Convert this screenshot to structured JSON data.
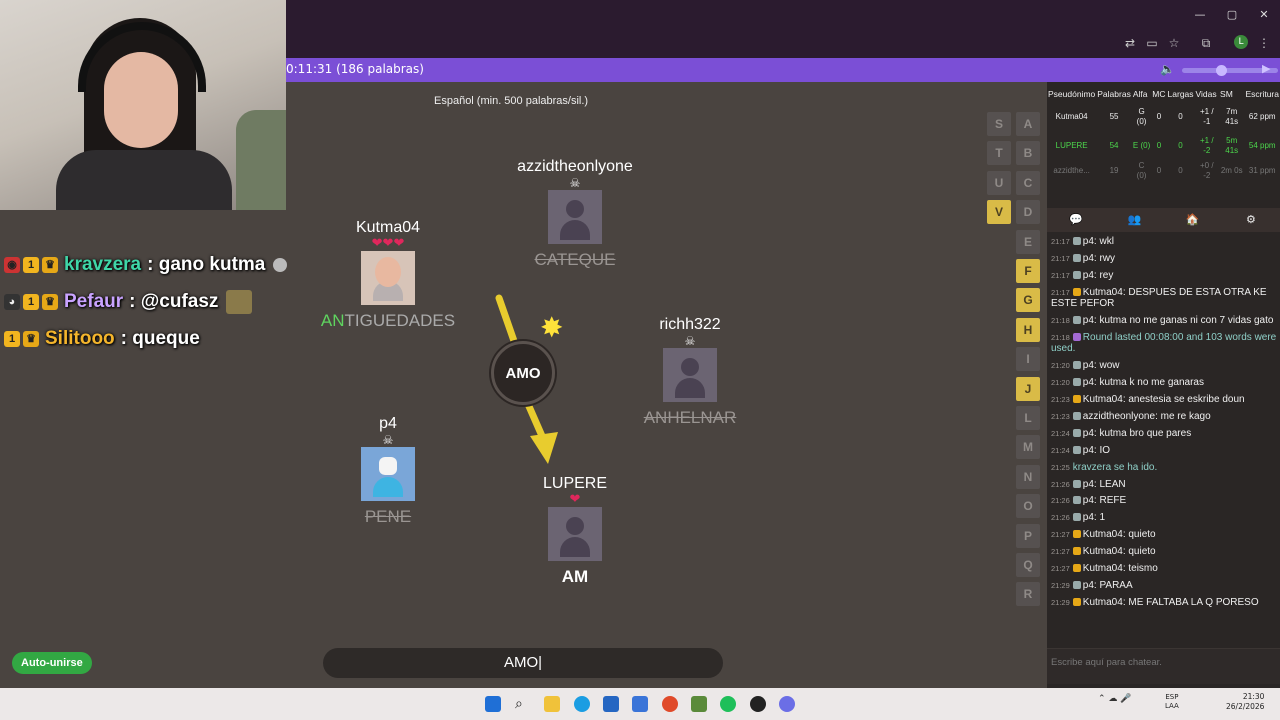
{
  "browser": {
    "window_controls": [
      "—",
      "▢",
      "✕"
    ],
    "profile_initial": "L"
  },
  "game_bar": {
    "timer": "0:11:31 (186 palabras)"
  },
  "stream_overlay": {
    "chat": [
      {
        "user": "kravzera",
        "user_color": "#3fd6a7",
        "message": ": gano kutma"
      },
      {
        "user": "Pefaur",
        "user_color": "#c9a3ff",
        "message": ": @cufasz"
      },
      {
        "user": "Silitooo",
        "user_color": "#f4b52c",
        "message": ": queque"
      }
    ]
  },
  "game": {
    "language": "Español (min. 500 palabras/sil.)",
    "bomb_syllable": "AMO",
    "players": [
      {
        "name": "azzidtheonlyone",
        "status": "dead",
        "word": "CATEQUE"
      },
      {
        "name": "Kutma04",
        "status": "alive",
        "lives": "❤❤❤",
        "word_highlight": "AN",
        "word_rest": "TIGUEDADES"
      },
      {
        "name": "richh322",
        "status": "dead",
        "word": "ANHELNAR"
      },
      {
        "name": "p4",
        "status": "dead",
        "word": "PENE"
      },
      {
        "name": "LUPERE",
        "status": "alive",
        "lives": "❤",
        "word": "AM"
      }
    ],
    "letters_col1": [
      {
        "letter": "S",
        "used": false
      },
      {
        "letter": "T",
        "used": false
      },
      {
        "letter": "U",
        "used": false
      },
      {
        "letter": "V",
        "used": true
      }
    ],
    "letters_col2": [
      {
        "letter": "A",
        "used": false
      },
      {
        "letter": "B",
        "used": false
      },
      {
        "letter": "C",
        "used": false
      },
      {
        "letter": "D",
        "used": false
      },
      {
        "letter": "E",
        "used": false
      },
      {
        "letter": "F",
        "used": true
      },
      {
        "letter": "G",
        "used": true
      },
      {
        "letter": "H",
        "used": true
      },
      {
        "letter": "I",
        "used": false
      },
      {
        "letter": "J",
        "used": true
      },
      {
        "letter": "L",
        "used": false
      },
      {
        "letter": "M",
        "used": false
      },
      {
        "letter": "N",
        "used": false
      },
      {
        "letter": "O",
        "used": false
      },
      {
        "letter": "P",
        "used": false
      },
      {
        "letter": "Q",
        "used": false
      },
      {
        "letter": "R",
        "used": false
      }
    ],
    "auto_join_label": "Auto-unirse",
    "input_value": "AMO"
  },
  "stats": {
    "headers": [
      "Pseudónimo",
      "Palabras",
      "Alfa",
      "MC",
      "Largas",
      "Vidas",
      "SM",
      "Escritura"
    ],
    "rows": [
      {
        "name": "Kutma04",
        "words": "55",
        "alfa": "G (0)",
        "mc": "0",
        "largas": "0",
        "vidas": "+1 / -1",
        "sm": "7m 41s",
        "speed": "62 ppm",
        "style": "normal"
      },
      {
        "name": "LUPERE",
        "words": "54",
        "alfa": "E (0)",
        "mc": "0",
        "largas": "0",
        "vidas": "+1 / -2",
        "sm": "5m 41s",
        "speed": "54 ppm",
        "style": "green"
      },
      {
        "name": "azzidthe...",
        "words": "19",
        "alfa": "C (0)",
        "mc": "0",
        "largas": "0",
        "vidas": "+0 / -2",
        "sm": "2m 0s",
        "speed": "31 ppm",
        "style": "faded"
      }
    ]
  },
  "chat": {
    "tabs": [
      "💬",
      "👥",
      "🏠",
      "⚙"
    ],
    "messages": [
      {
        "time": "21:17",
        "icon": "grey",
        "user": "p4",
        "text": "wkl"
      },
      {
        "time": "21:17",
        "icon": "grey",
        "user": "p4",
        "text": "rwy"
      },
      {
        "time": "21:17",
        "icon": "grey",
        "user": "p4",
        "text": "rey"
      },
      {
        "time": "21:17",
        "icon": "gold",
        "user": "Kutma04",
        "text": "DESPUES DE ESTA OTRA KE ESTE PEFOR"
      },
      {
        "time": "21:18",
        "icon": "grey",
        "user": "p4",
        "text": "kutma no me ganas ni con 7 vidas gato"
      },
      {
        "time": "21:18",
        "icon": "purple",
        "user": "",
        "text": "Round lasted 00:08:00 and 103 words were used.",
        "style": "sys2"
      },
      {
        "time": "21:20",
        "icon": "grey",
        "user": "p4",
        "text": "wow"
      },
      {
        "time": "21:20",
        "icon": "grey",
        "user": "p4",
        "text": "kutma k no me ganaras"
      },
      {
        "time": "21:23",
        "icon": "gold",
        "user": "Kutma04",
        "text": "anestesia se eskribe doun"
      },
      {
        "time": "21:23",
        "icon": "grey",
        "user": "azzidtheonlyone",
        "text": "me re kago"
      },
      {
        "time": "21:24",
        "icon": "grey",
        "user": "p4",
        "text": "kutma bro que pares"
      },
      {
        "time": "21:24",
        "icon": "grey",
        "user": "p4",
        "text": "IO"
      },
      {
        "time": "21:25",
        "icon": "",
        "user": "",
        "text": "kravzera se ha ido.",
        "style": "sys2"
      },
      {
        "time": "21:26",
        "icon": "grey",
        "user": "p4",
        "text": "LEAN"
      },
      {
        "time": "21:26",
        "icon": "grey",
        "user": "p4",
        "text": "REFE"
      },
      {
        "time": "21:26",
        "icon": "grey",
        "user": "p4",
        "text": "1"
      },
      {
        "time": "21:27",
        "icon": "gold",
        "user": "Kutma04",
        "text": "quieto"
      },
      {
        "time": "21:27",
        "icon": "gold",
        "user": "Kutma04",
        "text": "quieto"
      },
      {
        "time": "21:27",
        "icon": "gold",
        "user": "Kutma04",
        "text": "teismo"
      },
      {
        "time": "21:29",
        "icon": "grey",
        "user": "p4",
        "text": "PARAA"
      },
      {
        "time": "21:29",
        "icon": "gold",
        "user": "Kutma04",
        "text": "ME FALTABA LA Q PORESO"
      }
    ],
    "placeholder": "Escribe aquí para chatear."
  },
  "taskbar": {
    "lang": "ESP\nLAA",
    "time": "21:30",
    "date": "26/2/2026"
  }
}
